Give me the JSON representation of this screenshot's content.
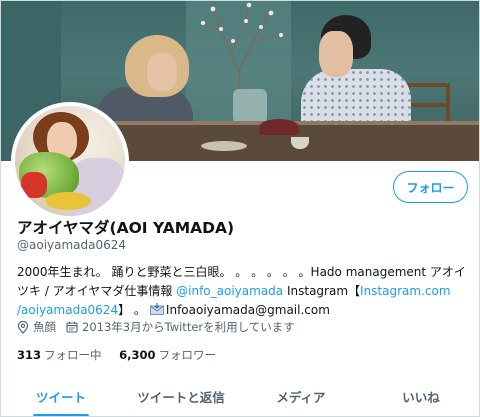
{
  "profile": {
    "display_name": "アオイヤマダ(AOI YAMADA)",
    "handle": "@aoiyamada0624",
    "follow_button": "フォロー"
  },
  "bio": {
    "text1": "2000年生まれ。 踊りと野菜と三白眼。 。 。 。 。 。Hado management アオイツキ / アオイヤマダ仕事情報 ",
    "link1": "@info_aoiyamada",
    "text2": " Instagram【",
    "link2": "Instagram.com /aoiyamada0624",
    "text3": "】 。",
    "email": "Infoaoiyamada@gmail.com"
  },
  "meta": {
    "location": "魚顔",
    "joined": "2013年3月からTwitterを利用しています"
  },
  "follows": {
    "following_count": "313",
    "following_label": "フォロー中",
    "followers_count": "6,300",
    "followers_label": "フォロワー"
  },
  "tabs": [
    {
      "label": "ツイート",
      "active": true
    },
    {
      "label": "ツイートと返信",
      "active": false
    },
    {
      "label": "メディア",
      "active": false
    },
    {
      "label": "いいね",
      "active": false
    }
  ],
  "colors": {
    "accent": "#1d9bf0",
    "secondary_text": "#536471"
  }
}
